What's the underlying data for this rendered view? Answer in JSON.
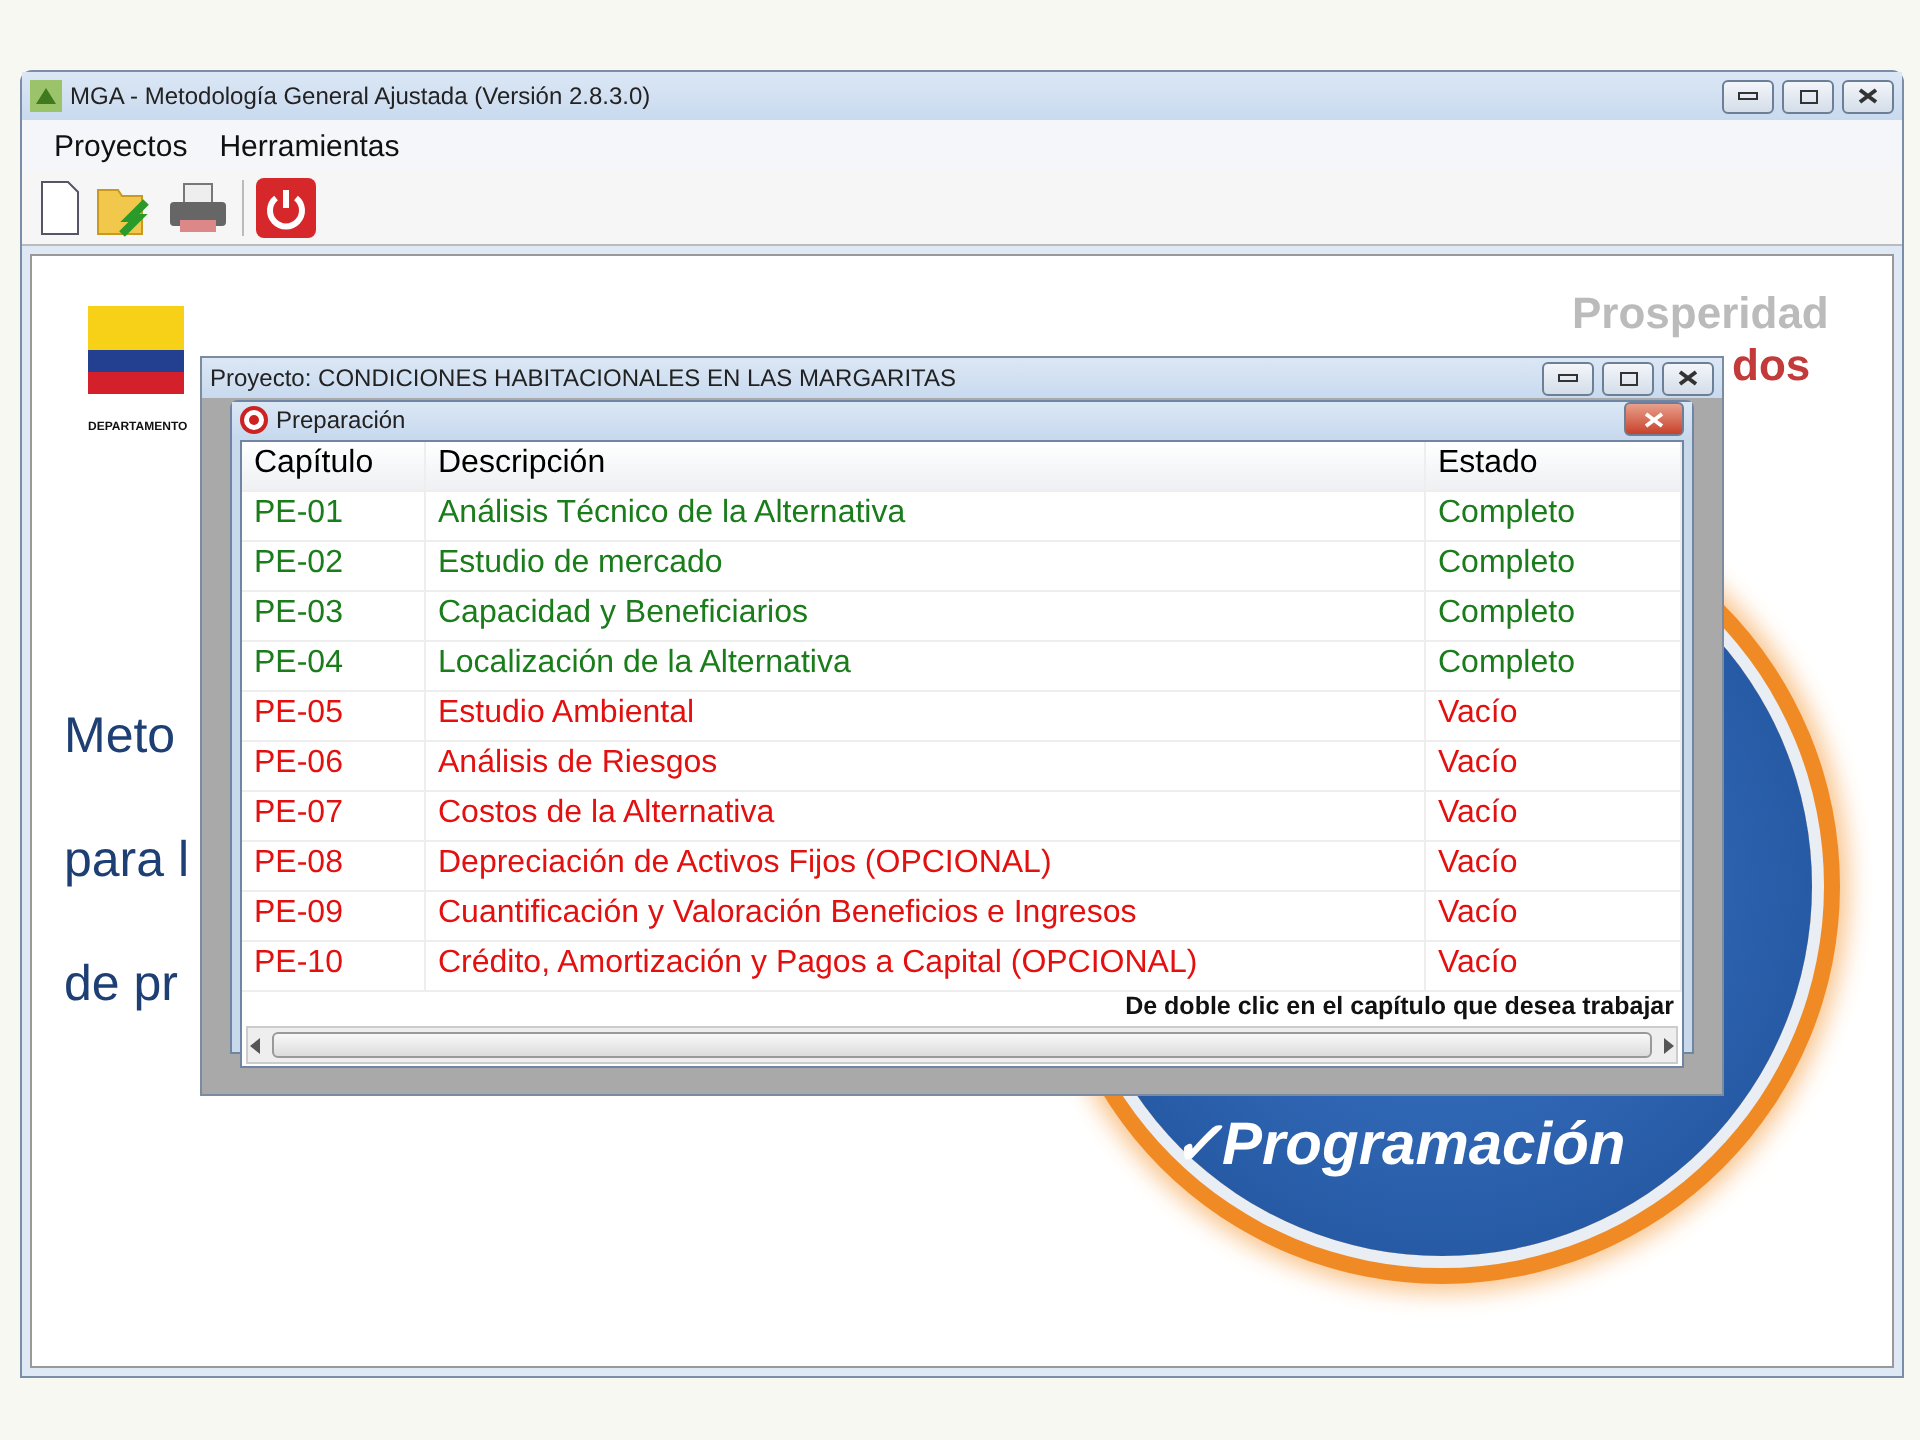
{
  "main_window": {
    "title": "MGA - Metodología General Ajustada (Versión 2.8.3.0)",
    "menu": [
      "Proyectos",
      "Herramientas"
    ]
  },
  "splash": {
    "department": "DEPARTAMENTO",
    "slogan": "Prosperidad",
    "slogan_tail": "dos",
    "intro_lines": [
      "Meto",
      "para l",
      "de pr"
    ],
    "badge": "✓Programación"
  },
  "project_window": {
    "title": "Proyecto: CONDICIONES HABITACIONALES EN LAS MARGARITAS"
  },
  "preparation_window": {
    "title": "Preparación",
    "columns": [
      "Capítulo",
      "Descripción",
      "Estado"
    ],
    "rows": [
      {
        "kind": "complete",
        "chapter": "PE-01",
        "description": "Análisis Técnico de la Alternativa",
        "status": "Completo"
      },
      {
        "kind": "complete",
        "chapter": "PE-02",
        "description": "Estudio de mercado",
        "status": "Completo"
      },
      {
        "kind": "complete",
        "chapter": "PE-03",
        "description": "Capacidad y Beneficiarios",
        "status": "Completo"
      },
      {
        "kind": "complete",
        "chapter": "PE-04",
        "description": "Localización de la Alternativa",
        "status": "Completo"
      },
      {
        "kind": "empty",
        "chapter": "PE-05",
        "description": "Estudio Ambiental",
        "status": "Vacío"
      },
      {
        "kind": "empty",
        "chapter": "PE-06",
        "description": "Análisis de Riesgos",
        "status": "Vacío"
      },
      {
        "kind": "empty",
        "chapter": "PE-07",
        "description": "Costos de la Alternativa",
        "status": "Vacío"
      },
      {
        "kind": "empty",
        "chapter": "PE-08",
        "description": "Depreciación de Activos Fijos (OPCIONAL)",
        "status": "Vacío"
      },
      {
        "kind": "empty",
        "chapter": "PE-09",
        "description": "Cuantificación y Valoración Beneficios e Ingresos",
        "status": "Vacío"
      },
      {
        "kind": "empty",
        "chapter": "PE-10",
        "description": "Crédito, Amortización y Pagos a Capital (OPCIONAL)",
        "status": "Vacío"
      }
    ],
    "hint": "De doble clic en el capítulo que desea trabajar"
  }
}
